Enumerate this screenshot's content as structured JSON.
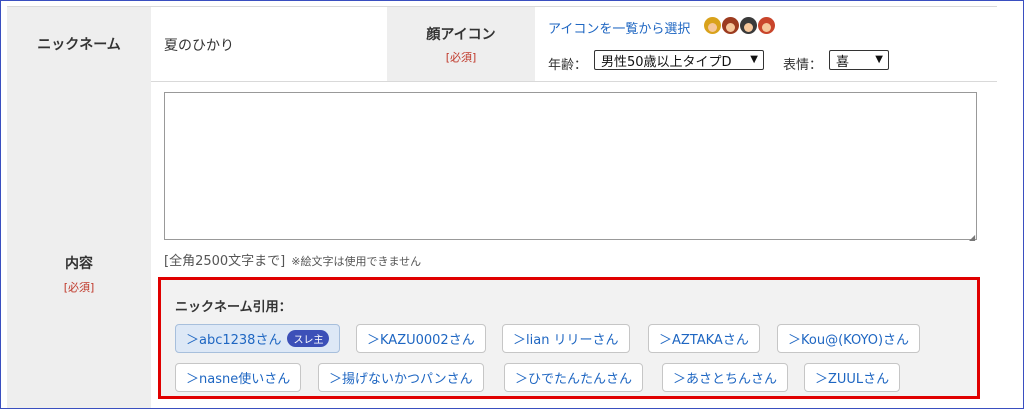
{
  "nickname": {
    "label": "ニックネーム",
    "value": "夏のひかり"
  },
  "face_icon": {
    "label": "顔アイコン",
    "required": "[必須]",
    "select_link": "アイコンを一覧から選択",
    "avatars": [
      "avatar-1",
      "avatar-2",
      "avatar-3",
      "avatar-4"
    ],
    "age_label": "年齢：",
    "age_value": "男性50歳以上タイプD",
    "expression_label": "表情：",
    "expression_value": "喜"
  },
  "content": {
    "label": "内容",
    "required": "[必須]",
    "textarea_value": "",
    "limit_text": "[全角2500文字まで]",
    "emoji_note": "※絵文字は使用できません"
  },
  "quote": {
    "title": "ニックネーム引用：",
    "chips": [
      {
        "label": "＞abc1238さん",
        "badge": "スレ主"
      },
      {
        "label": "＞KAZU0002さん"
      },
      {
        "label": "＞lian リリーさん"
      },
      {
        "label": "＞AZTAKAさん"
      },
      {
        "label": "＞Kou@(KOYO)さん"
      },
      {
        "label": "＞nasne使いさん"
      },
      {
        "label": "＞揚げないかつパンさん"
      },
      {
        "label": "＞ひでたんたんさん"
      },
      {
        "label": "＞あさとちんさん"
      },
      {
        "label": "＞ZUULさん"
      }
    ]
  },
  "colors": {
    "accent_link": "#1e66c2",
    "required_red": "#c0392b",
    "highlight_border": "#e00000",
    "badge_bg": "#3c50b8"
  }
}
